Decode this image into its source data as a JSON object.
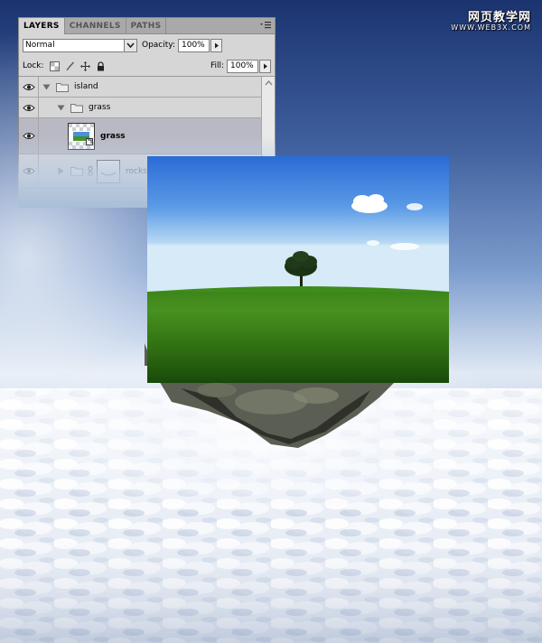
{
  "watermark": {
    "cn": "网页教学网",
    "url": "WWW.WEB3X.COM"
  },
  "panel": {
    "tabs": [
      {
        "label": "LAYERS",
        "active": true
      },
      {
        "label": "CHANNELS",
        "active": false
      },
      {
        "label": "PATHS",
        "active": false
      }
    ],
    "blend_mode": "Normal",
    "opacity_label": "Opacity:",
    "opacity_value": "100%",
    "lock_label": "Lock:",
    "fill_label": "Fill:",
    "fill_value": "100%",
    "layers": [
      {
        "name": "island",
        "type": "group",
        "expanded": true,
        "visible": true
      },
      {
        "name": "grass",
        "type": "group",
        "expanded": true,
        "visible": true
      },
      {
        "name": "grass",
        "type": "smart-object",
        "selected": true,
        "visible": true
      },
      {
        "name": "rocks",
        "type": "group",
        "expanded": false,
        "visible": true,
        "has_mask": true
      }
    ]
  },
  "colors": {
    "sky_top": "#1e3a78",
    "sky_mid": "#6f8fc4",
    "cloud": "#f4f6fa",
    "grass_dark": "#1f5e0f",
    "grass_light": "#4f9a1c",
    "photo_sky_top": "#2f72d8",
    "photo_sky_bottom": "#cfe6f8",
    "selected_row": "#b9b9c4",
    "panel_bg": "#d6d6d6"
  }
}
